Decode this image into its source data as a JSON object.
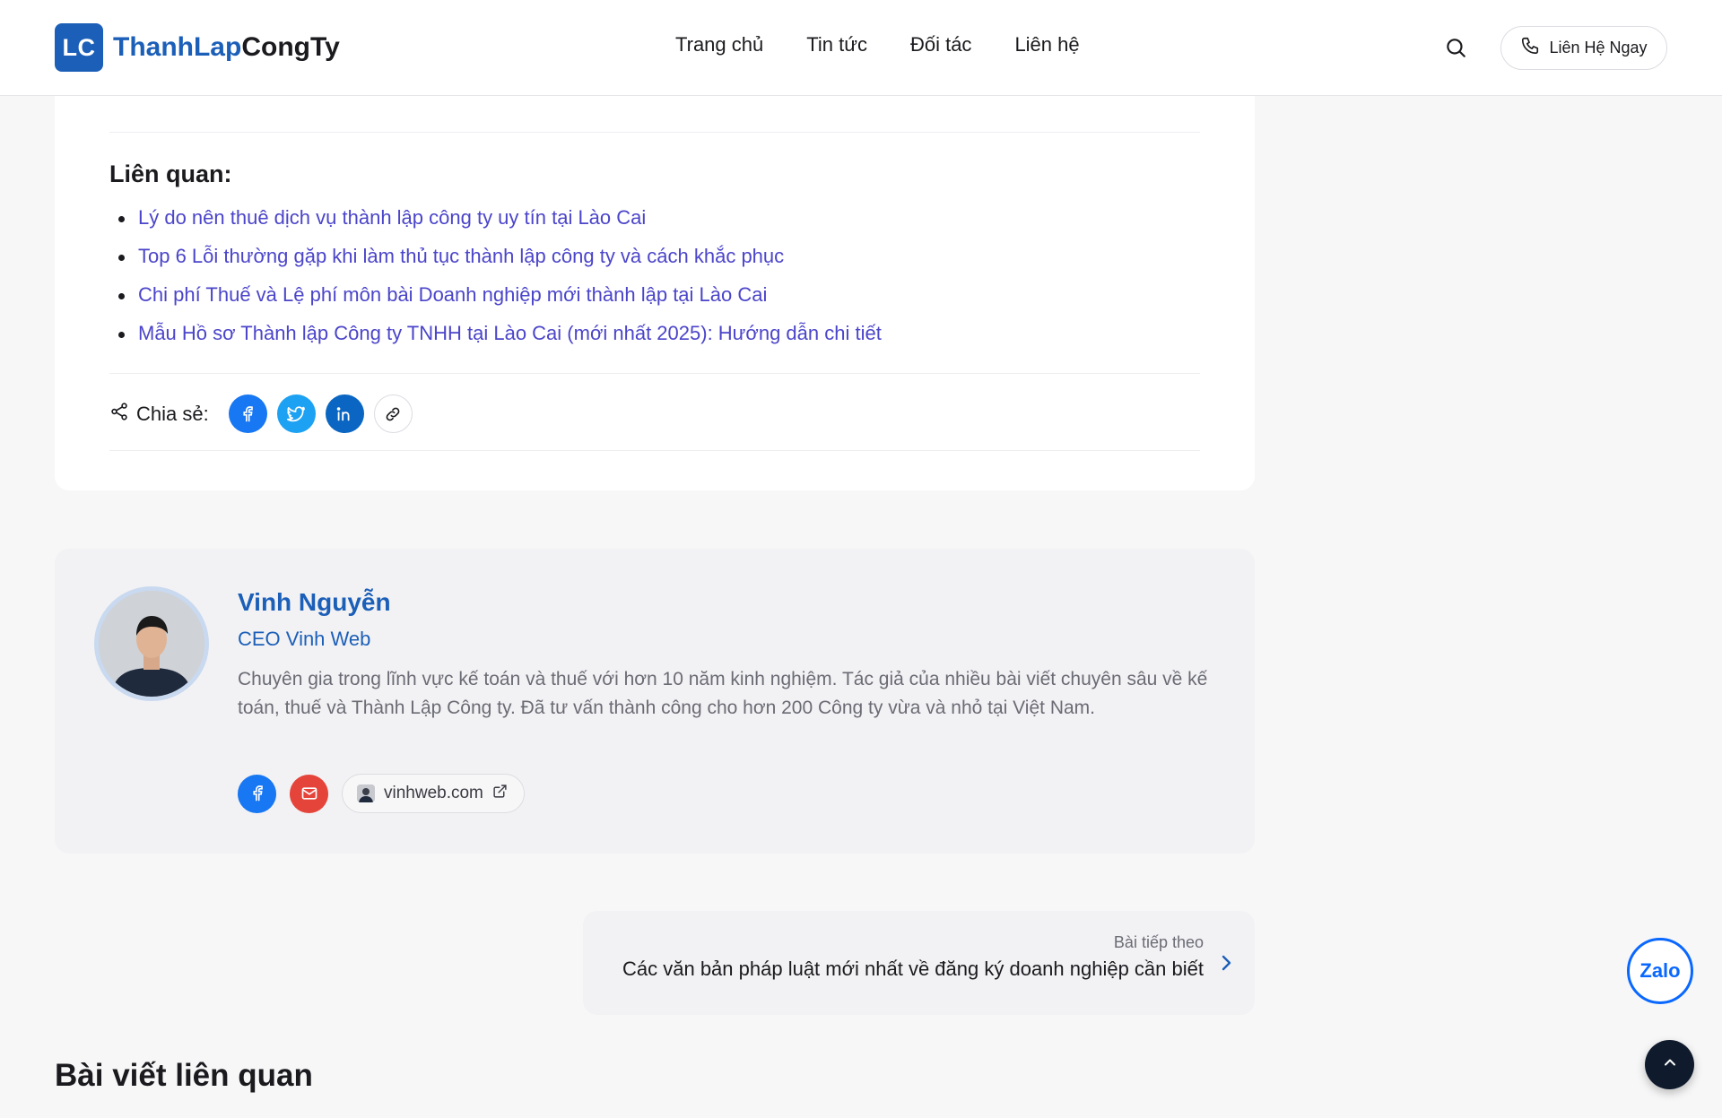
{
  "header": {
    "logo_badge": "LC",
    "logo_part1": "ThanhLap",
    "logo_part2": "CongTy",
    "nav": [
      "Trang chủ",
      "Tin tức",
      "Đối tác",
      "Liên hệ"
    ],
    "contact_button": "Liên Hệ Ngay",
    "search_icon": "search-icon",
    "phone_icon": "phone-icon"
  },
  "related": {
    "title": "Liên quan:",
    "links": [
      "Lý do nên thuê dịch vụ thành lập công ty uy tín tại Lào Cai",
      "Top 6 Lỗi thường gặp khi làm thủ tục thành lập công ty và cách khắc phục",
      "Chi phí Thuế và Lệ phí môn bài Doanh nghiệp mới thành lập tại Lào Cai",
      "Mẫu Hồ sơ Thành lập Công ty TNHH tại Lào Cai (mới nhất 2025): Hướng dẫn chi tiết"
    ],
    "link_color": "#4b45c9"
  },
  "share": {
    "label": "Chia sẻ:",
    "icons": [
      "share-icon",
      "facebook-icon",
      "twitter-icon",
      "linkedin-icon",
      "link-icon"
    ]
  },
  "author": {
    "name": "Vinh Nguyễn",
    "role": "CEO Vinh Web",
    "bio": "Chuyên gia trong lĩnh vực kế toán và thuế với hơn 10 năm kinh nghiệm. Tác giả của nhiều bài viết chuyên sâu về kế toán, thuế và Thành Lập Công ty. Đã tư vấn thành công cho hơn 200 Công ty vừa và nhỏ tại Việt Nam.",
    "website": "vinhweb.com",
    "icons": [
      "facebook-icon",
      "mail-icon",
      "external-link-icon"
    ],
    "accent": "#1c5fb8"
  },
  "next_post": {
    "label": "Bài tiếp theo",
    "title": "Các văn bản pháp luật mới nhất về đăng ký doanh nghiệp cần biết"
  },
  "related_posts_heading": "Bài viết liên quan",
  "floating": {
    "zalo_label": "Zalo",
    "back_to_top_icon": "chevron-up-icon"
  }
}
